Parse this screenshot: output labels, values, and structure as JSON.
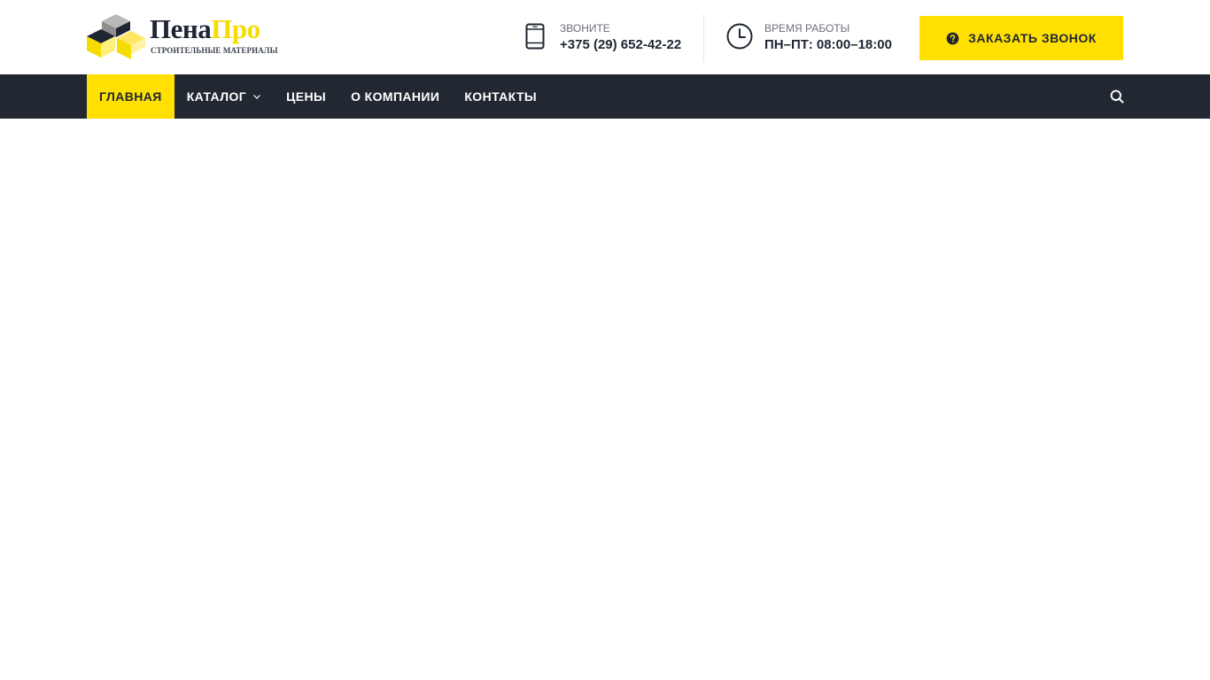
{
  "brand": {
    "name_part1": "Пена",
    "name_part2": "Про",
    "tagline": "СТРОИТЕЛЬНЫЕ МАТЕРИАЛЫ",
    "color_dark": "#1f2633",
    "color_yellow": "#f6dc00"
  },
  "header": {
    "phone": {
      "label": "ЗВОНИТЕ",
      "value": "+375 (29) 652-42-22",
      "icon": "mobile-phone-icon"
    },
    "hours": {
      "label": "ВРЕМЯ РАБОТЫ",
      "value": "ПН–ПТ: 08:00–18:00",
      "icon": "clock-icon"
    },
    "callback_button": {
      "label": "ЗАКАЗАТЬ ЗВОНОК",
      "icon": "question-circle-icon",
      "color": "#ffe000"
    }
  },
  "nav": {
    "background": "#222831",
    "items": [
      {
        "label": "ГЛАВНАЯ",
        "active": true
      },
      {
        "label": "КАТАЛОГ",
        "has_dropdown": true
      },
      {
        "label": "ЦЕНЫ"
      },
      {
        "label": "О КОМПАНИИ"
      },
      {
        "label": "КОНТАКТЫ"
      }
    ],
    "search_icon": "search-icon"
  }
}
